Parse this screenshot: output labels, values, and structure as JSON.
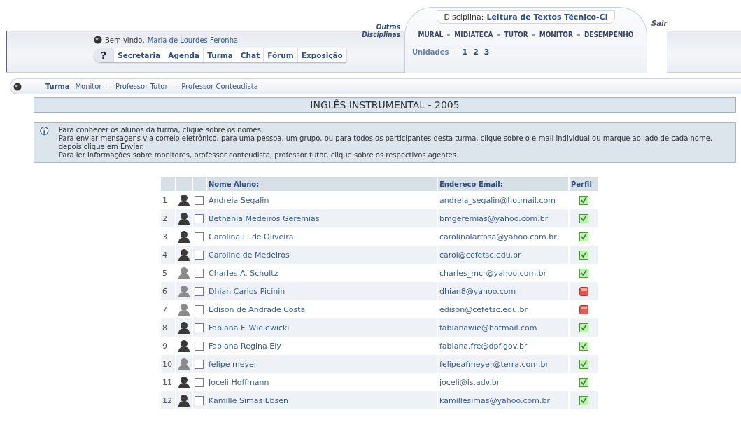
{
  "header": {
    "welcome_label": "Bem vindo,",
    "user_name": "Maria de Lourdes Feronha",
    "help": "?",
    "tabs": [
      {
        "label": "Secretaria"
      },
      {
        "label": "Agenda"
      },
      {
        "label": "Turma"
      },
      {
        "label": "Chat"
      },
      {
        "label": "Fórum"
      },
      {
        "label": "Exposição"
      }
    ],
    "other_courses": "Outras Disciplinas",
    "course_label": "Disciplina:",
    "course_name": "Leitura de Textos Técnico-Ci",
    "course_nav": [
      {
        "label": "MURAL"
      },
      {
        "label": "MIDIATECA"
      },
      {
        "label": "TUTOR"
      },
      {
        "label": "MONITOR"
      },
      {
        "label": "DESEMPENHO"
      }
    ],
    "units_label": "Unidades",
    "units": [
      "1",
      "2",
      "3"
    ],
    "logout": "Sair"
  },
  "subnav": {
    "title": "Turma",
    "links": [
      "Monitor",
      "Professor Tutor",
      "Professor Conteudista"
    ],
    "separator": "-"
  },
  "page_title": "INGLÊS INSTRUMENTAL - 2005",
  "info": [
    "Para conhecer os alunos da turma, clique sobre os nomes.",
    "Para enviar mensagens via correio eletrônico, para uma pessoa, um grupo, ou para todos os participantes desta turma, clique sobre o e-mail individual ou marque ao lado de cada nome, depois clique em Enviar.",
    "Para ler informações sobre monitores, professor conteudista, professor tutor, clique sobre os respectivos agentes."
  ],
  "table": {
    "columns": [
      "Nome Aluno:",
      "Endereço Email:",
      "Perfil"
    ],
    "rows": [
      {
        "number": "1",
        "color": "#3a3a3a",
        "checked": false,
        "name": "Andreia Segalin",
        "email": "andreia_segalin@hotmail.com",
        "profile_filled": true
      },
      {
        "number": "2",
        "color": "#3a3a3a",
        "checked": false,
        "name": "Bethania Medeiros Geremias",
        "email": "bmgeremias@yahoo.com.br",
        "profile_filled": true
      },
      {
        "number": "3",
        "color": "#3a3a3a",
        "checked": false,
        "name": "Carolina L. de Oliveira",
        "email": "carolinalarrosa@yahoo.com.br",
        "profile_filled": true
      },
      {
        "number": "4",
        "color": "#3a3a3a",
        "checked": false,
        "name": "Caroline de Medeiros",
        "email": "carol@cefetsc.edu.br",
        "profile_filled": true
      },
      {
        "number": "5",
        "color": "#8a8a8a",
        "checked": false,
        "name": "Charles A. Schultz",
        "email": "charles_mcr@yahoo.com.br",
        "profile_filled": true
      },
      {
        "number": "6",
        "color": "#8a8a8a",
        "checked": false,
        "name": "Dhian Carlos Picinin",
        "email": "dhian8@yahoo.com",
        "profile_filled": false
      },
      {
        "number": "7",
        "color": "#8a8a8a",
        "checked": false,
        "name": "Edison de Andrade Costa",
        "email": "edison@cefetsc.edu.br",
        "profile_filled": false
      },
      {
        "number": "8",
        "color": "#3a3a3a",
        "checked": false,
        "name": "Fabiana F. Wielewicki",
        "email": "fabianawie@hotmail.com",
        "profile_filled": true
      },
      {
        "number": "9",
        "color": "#3a3a3a",
        "checked": false,
        "name": "Fabiana Regina Ely",
        "email": "fabiana.fre@dpf.gov.br",
        "profile_filled": true
      },
      {
        "number": "10",
        "color": "#8a8a8a",
        "checked": false,
        "name": "felipe meyer",
        "email": "felipeafmeyer@terra.com.br",
        "profile_filled": true
      },
      {
        "number": "11",
        "color": "#3a3a3a",
        "checked": false,
        "name": "Joceli Hoffmann",
        "email": "joceli@ls.adv.br",
        "profile_filled": true
      },
      {
        "number": "12",
        "color": "#3a3a3a",
        "checked": false,
        "name": "Kamille Simas Ebsen",
        "email": "kamillesimas@yahoo.com.br",
        "profile_filled": true
      }
    ]
  }
}
